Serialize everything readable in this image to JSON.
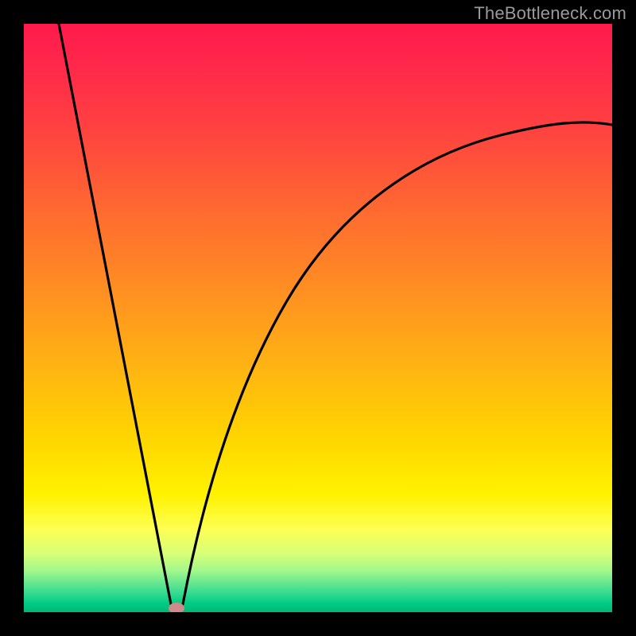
{
  "watermark": "TheBottleneck.com",
  "chart_data": {
    "type": "line",
    "title": "",
    "xlabel": "",
    "ylabel": "",
    "xlim": [
      0,
      100
    ],
    "ylim": [
      0,
      100
    ],
    "curve": {
      "minimum_x": 26,
      "minimum_y": 0,
      "left_branch_start": {
        "x": 6,
        "y": 100
      },
      "right_branch_end": {
        "x": 100,
        "y": 82
      },
      "x": [
        6,
        8,
        10,
        12,
        14,
        16,
        18,
        20,
        22,
        24,
        26,
        28,
        30,
        32,
        34,
        36,
        38,
        40,
        44,
        48,
        52,
        56,
        60,
        64,
        68,
        72,
        76,
        80,
        84,
        88,
        92,
        96,
        100
      ],
      "y": [
        100,
        90,
        80,
        70,
        60,
        50,
        40,
        30,
        20,
        9,
        0,
        10,
        20,
        29,
        36,
        42,
        47,
        51,
        57,
        62,
        65.5,
        68.5,
        71,
        73,
        74.8,
        76.3,
        77.5,
        78.6,
        79.5,
        80.3,
        81,
        81.5,
        82
      ]
    },
    "marker": {
      "x": 26,
      "y": 0,
      "color": "#d98080",
      "shape": "rounded"
    },
    "gradient_stops": [
      {
        "pos": 0,
        "color": "#ff1a4d"
      },
      {
        "pos": 50,
        "color": "#ff9a1c"
      },
      {
        "pos": 80,
        "color": "#fff200"
      },
      {
        "pos": 100,
        "color": "#00b877"
      }
    ]
  }
}
